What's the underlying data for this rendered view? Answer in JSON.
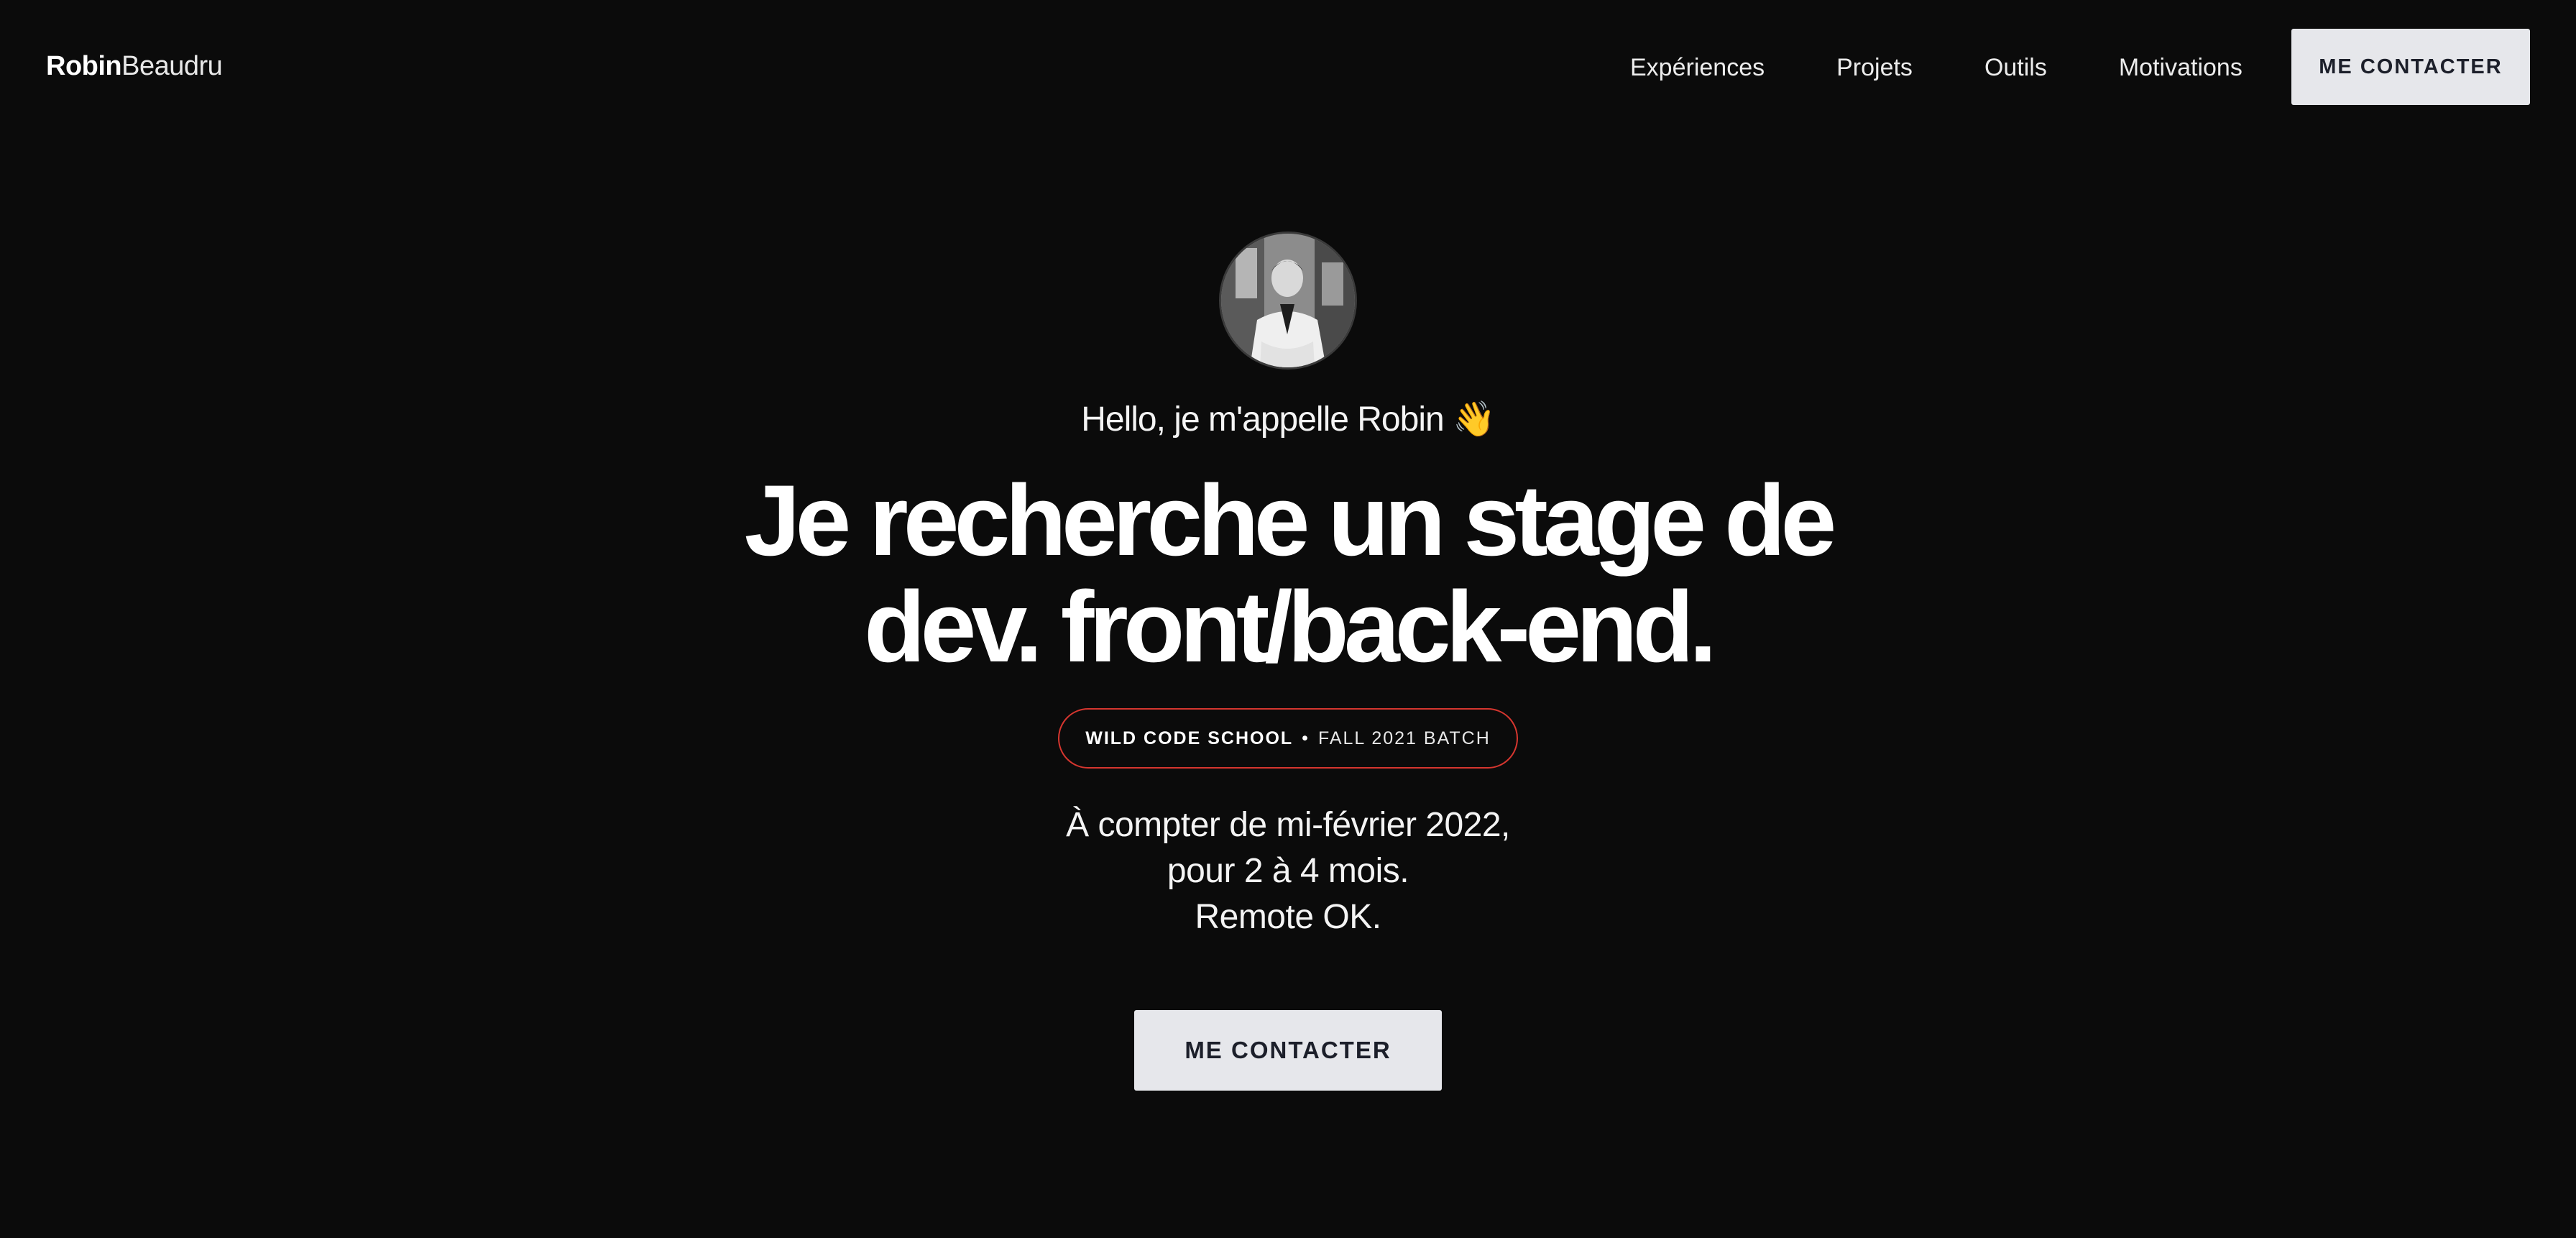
{
  "header": {
    "logo_first": "Robin",
    "logo_last": "Beaudru",
    "nav": [
      {
        "label": "Expériences"
      },
      {
        "label": "Projets"
      },
      {
        "label": "Outils"
      },
      {
        "label": "Motivations"
      }
    ],
    "cta_label": "ME CONTACTER"
  },
  "hero": {
    "greeting": "Hello, je m'appelle Robin 👋",
    "headline_line1": "Je recherche un stage de",
    "headline_line2": "dev. front/back-end.",
    "badge": {
      "school": "WILD CODE SCHOOL",
      "separator": "•",
      "batch": "FALL 2021 BATCH",
      "border_color": "#d6362f"
    },
    "details": [
      "À compter de mi-février 2022,",
      "pour 2 à 4 mois.",
      "Remote OK."
    ],
    "cta_label": "ME CONTACTER"
  },
  "colors": {
    "background": "#0b0b0b",
    "button_bg": "#e6e7eb",
    "button_text": "#1c1f2a"
  }
}
